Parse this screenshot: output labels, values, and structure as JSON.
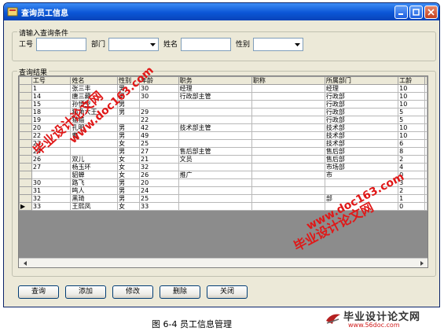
{
  "window": {
    "title": "查询员工信息"
  },
  "query_group": {
    "title": "请输入查询条件",
    "fields": [
      {
        "label": "工号",
        "value": ""
      },
      {
        "label": "部门",
        "value": ""
      },
      {
        "label": "姓名",
        "value": ""
      },
      {
        "label": "性别",
        "value": ""
      }
    ]
  },
  "results_group": {
    "title": "查询结果"
  },
  "grid": {
    "columns": [
      "工号",
      "姓名",
      "性别",
      "年龄",
      "职务",
      "职称",
      "所属部门",
      "工龄"
    ],
    "rows": [
      [
        "1",
        "张三丰",
        "男",
        "30",
        "经理",
        "",
        "经理",
        "10"
      ],
      [
        "14",
        "唐三藏",
        "男",
        "30",
        "行政部主管",
        "",
        "行政部",
        "10"
      ],
      [
        "15",
        "孙悟空",
        "男",
        "",
        "",
        "",
        "行政部",
        "10"
      ],
      [
        "18",
        "猫角大王",
        "男",
        "29",
        "",
        "",
        "行政部",
        "5"
      ],
      [
        "19",
        "猫猫",
        "",
        "22",
        "",
        "",
        "行政部",
        "5"
      ],
      [
        "20",
        "孔明",
        "男",
        "42",
        "技术部主管",
        "",
        "技术部",
        "10"
      ],
      [
        "22",
        "曹",
        "男",
        "49",
        "",
        "",
        "技术部",
        "10"
      ],
      [
        "23",
        "",
        "女",
        "25",
        "",
        "",
        "技术部",
        "6"
      ],
      [
        "24",
        "",
        "男",
        "27",
        "售后部主管",
        "",
        "售后部",
        "8"
      ],
      [
        "26",
        "双儿",
        "女",
        "21",
        "文员",
        "",
        "售后部",
        "2"
      ],
      [
        "27",
        "杨玉环",
        "女",
        "32",
        "",
        "",
        "市场部",
        "4"
      ],
      [
        "",
        "貂蝉",
        "女",
        "26",
        "推广",
        "",
        "市",
        "0"
      ],
      [
        "30",
        "路飞",
        "男",
        "20",
        "",
        "",
        "",
        "3"
      ],
      [
        "31",
        "鸣人",
        "男",
        "24",
        "",
        "",
        "",
        "2"
      ],
      [
        "32",
        "黑琦",
        "男",
        "25",
        "",
        "",
        "部",
        "1"
      ],
      [
        "33",
        "王熙凤",
        "女",
        "33",
        "",
        "",
        "",
        "0"
      ]
    ],
    "current_row_marker": "▶"
  },
  "buttons": [
    "查询",
    "添加",
    "修改",
    "删除",
    "关闭"
  ],
  "caption": "图 6-4  员工信息管理",
  "watermarks": {
    "site_cn": "毕业设计论文网",
    "site_url": "www.doc163.com",
    "brand_name": "毕业设计论文网",
    "brand_url": "www.56doc.com"
  },
  "colors": {
    "titlebar": "#0b56d6",
    "window_bg": "#ece9d8",
    "watermark": "#e01818"
  }
}
